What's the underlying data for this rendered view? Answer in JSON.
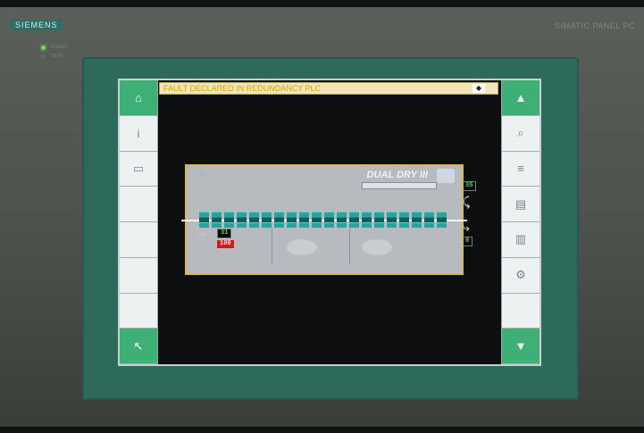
{
  "device": {
    "brand": "SIEMENS",
    "model": "SIMATIC PANEL PC",
    "leds": [
      {
        "label": "POWER",
        "color": "#7bd94a"
      },
      {
        "label": "TEMP",
        "color": "#5e6a5c"
      }
    ]
  },
  "alarm": {
    "message": "FAULT DECLARED IN REDUNDANCY PLC",
    "scroll_symbol": "◆"
  },
  "left_toolbar": {
    "items": [
      {
        "name": "home-button",
        "symbol": "⌂",
        "style": "green"
      },
      {
        "name": "info-button",
        "symbol": "i",
        "style": "plain"
      },
      {
        "name": "page-button",
        "symbol": "▭",
        "style": "plain"
      },
      {
        "name": "blank-button-1",
        "symbol": "",
        "style": "plain"
      },
      {
        "name": "blank-button-2",
        "symbol": "",
        "style": "plain"
      },
      {
        "name": "blank-button-3",
        "symbol": "",
        "style": "plain"
      },
      {
        "name": "blank-button-4",
        "symbol": "",
        "style": "plain"
      },
      {
        "name": "back-button",
        "symbol": "↖",
        "style": "green"
      }
    ]
  },
  "right_toolbar": {
    "items": [
      {
        "name": "scroll-up-button",
        "symbol": "▲",
        "style": "green"
      },
      {
        "name": "zoom-button",
        "symbol": "⌕",
        "style": "plain"
      },
      {
        "name": "trend-button",
        "symbol": "≡",
        "style": "plain"
      },
      {
        "name": "list-button",
        "symbol": "▤",
        "style": "plain"
      },
      {
        "name": "report-button",
        "symbol": "▥",
        "style": "plain"
      },
      {
        "name": "settings-button",
        "symbol": "⚙",
        "style": "plain"
      },
      {
        "name": "blank-button-5",
        "symbol": "",
        "style": "plain"
      },
      {
        "name": "scroll-down-button",
        "symbol": "▼",
        "style": "green"
      }
    ]
  },
  "process_panel": {
    "title": "DUAL DRY III",
    "tag_icon": "♡",
    "unit_count": 20,
    "readouts": {
      "top_right": "35",
      "bottom_right": "0",
      "left_green": "31",
      "left_red": "100"
    }
  },
  "colors": {
    "alarm_text": "#d6a300",
    "accent_green": "#3fb075",
    "frame_green": "#2e6a5b",
    "panel_border": "#d8b84a"
  }
}
